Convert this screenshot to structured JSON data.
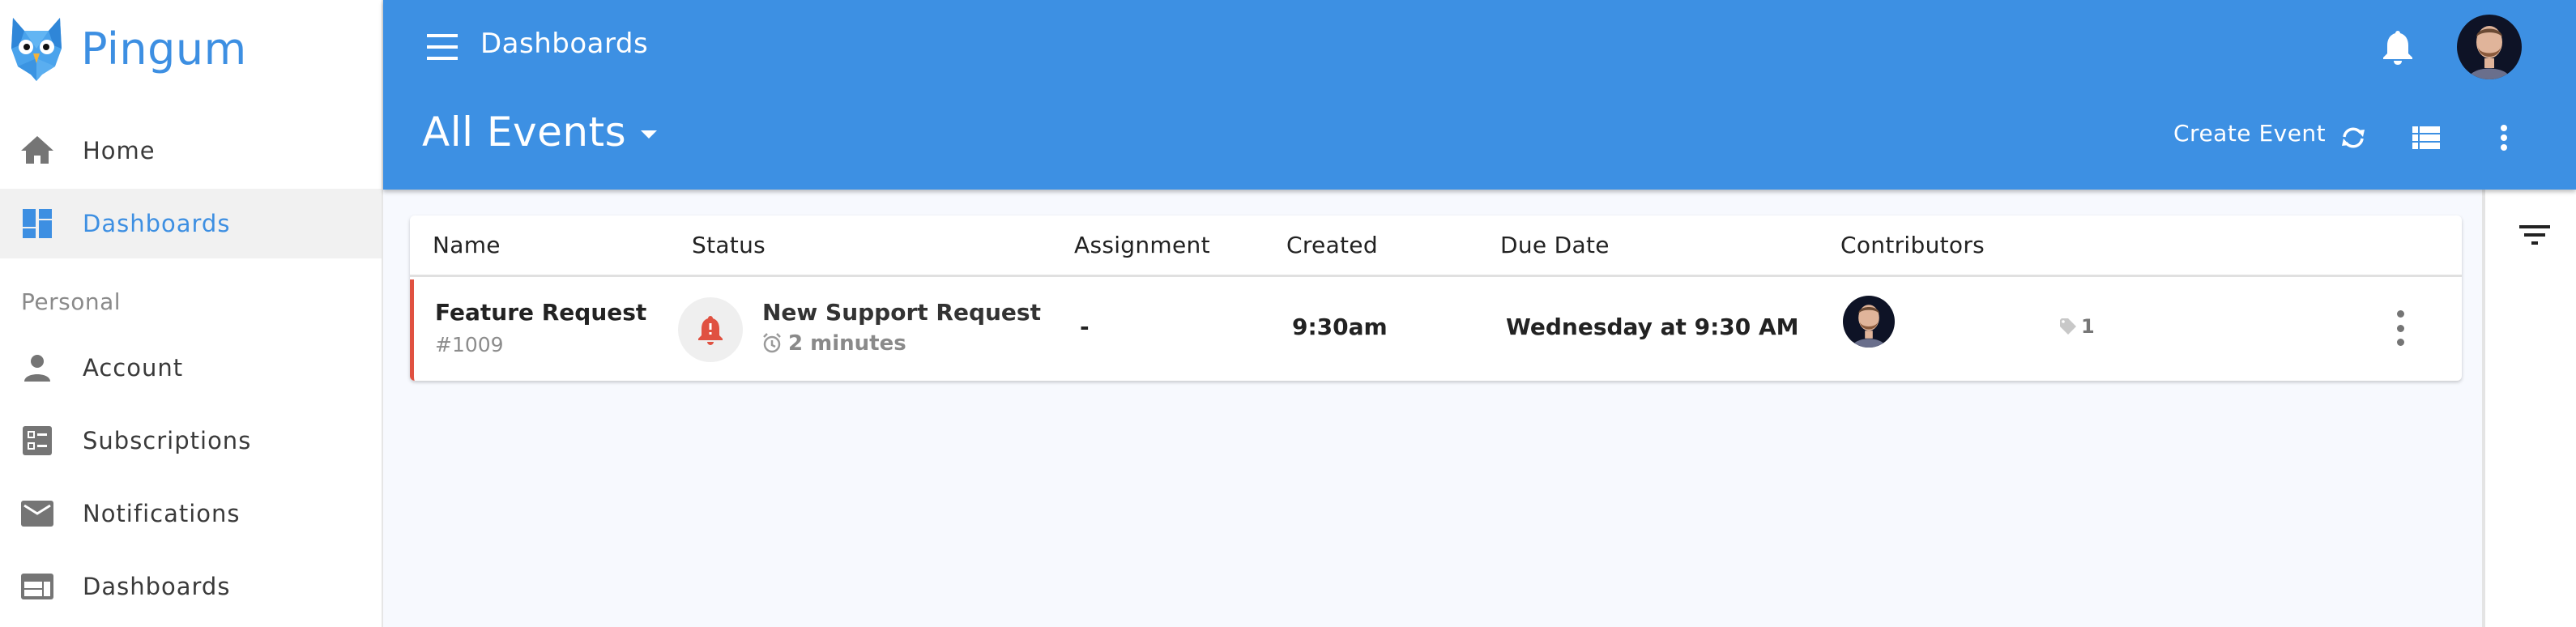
{
  "app": {
    "brand": "Pingum",
    "accent_color": "#3d90e3",
    "alert_color": "#e05141"
  },
  "sidebar": {
    "items": [
      {
        "label": "Home",
        "icon": "home-icon"
      },
      {
        "label": "Dashboards",
        "icon": "dashboard-icon",
        "active": true
      }
    ],
    "section_label": "Personal",
    "personal_items": [
      {
        "label": "Account",
        "icon": "person-icon"
      },
      {
        "label": "Subscriptions",
        "icon": "checklist-icon"
      },
      {
        "label": "Notifications",
        "icon": "mail-icon"
      },
      {
        "label": "Dashboards",
        "icon": "web-layout-icon"
      }
    ]
  },
  "header": {
    "title": "Dashboards",
    "view_selector": "All Events",
    "create_label": "Create Event",
    "icons": [
      "menu-icon",
      "bell-icon",
      "avatar",
      "refresh-icon",
      "list-view-icon",
      "more-vert-icon"
    ]
  },
  "table": {
    "columns": [
      "Name",
      "Status",
      "Assignment",
      "Created",
      "Due Date",
      "Contributors"
    ],
    "rows": [
      {
        "name": "Feature Request",
        "id": "#1009",
        "status_title": "New Support Request",
        "status_time": "2 minutes",
        "assignment": "-",
        "created": "9:30am",
        "due_date": "Wednesday at 9:30 AM",
        "tag_count": "1"
      }
    ]
  },
  "right_panel": {
    "icons": [
      "filter-icon"
    ]
  }
}
